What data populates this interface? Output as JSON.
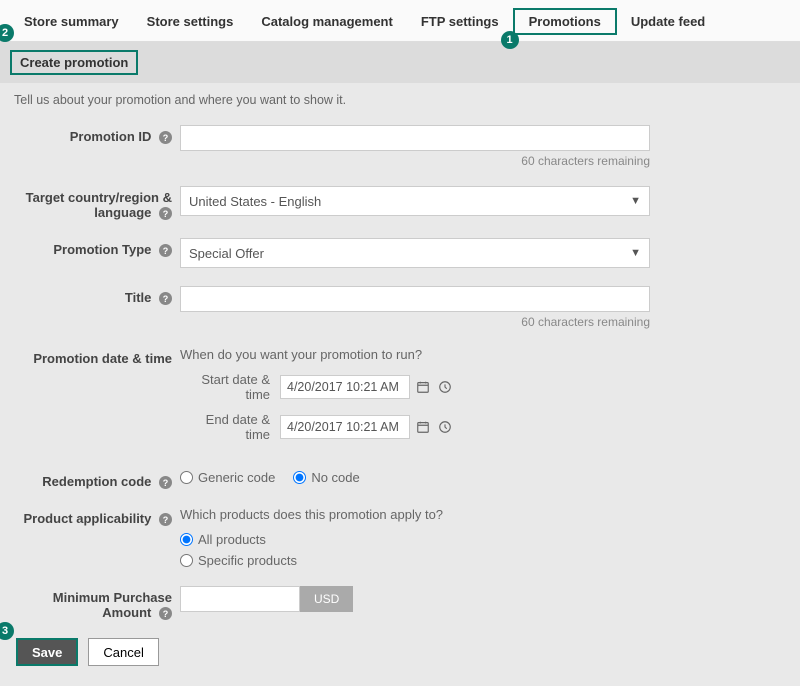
{
  "tabs": {
    "items": [
      "Store summary",
      "Store settings",
      "Catalog management",
      "FTP settings",
      "Promotions",
      "Update feed"
    ],
    "selected_index": 4
  },
  "annotations": {
    "a1": "1",
    "a2": "2",
    "a3": "3"
  },
  "section": {
    "title": "Create promotion"
  },
  "subdesc": "Tell us about your promotion and where you want to show it.",
  "labels": {
    "promotion_id": "Promotion ID",
    "target": "Target country/region & language",
    "promotion_type": "Promotion Type",
    "title": "Title",
    "date_time": "Promotion date & time",
    "redemption": "Redemption code",
    "applicability": "Product applicability",
    "min_purchase": "Minimum Purchase Amount"
  },
  "fields": {
    "promotion_id": {
      "value": "",
      "hint": "60 characters remaining"
    },
    "target": {
      "value": "United States - English"
    },
    "promotion_type": {
      "value": "Special Offer"
    },
    "title": {
      "value": "",
      "hint": "60 characters remaining"
    },
    "date": {
      "desc": "When do you want your promotion to run?",
      "start_label": "Start date & time",
      "end_label": "End date & time",
      "start_value": "4/20/2017 10:21 AM",
      "end_value": "4/20/2017 10:21 AM"
    },
    "redemption": {
      "opt_generic": "Generic code",
      "opt_none": "No code",
      "selected": "none"
    },
    "applicability": {
      "desc": "Which products does this promotion apply to?",
      "opt_all": "All products",
      "opt_specific": "Specific products",
      "selected": "all"
    },
    "min_purchase": {
      "value": "",
      "currency": "USD"
    }
  },
  "buttons": {
    "save": "Save",
    "cancel": "Cancel"
  }
}
